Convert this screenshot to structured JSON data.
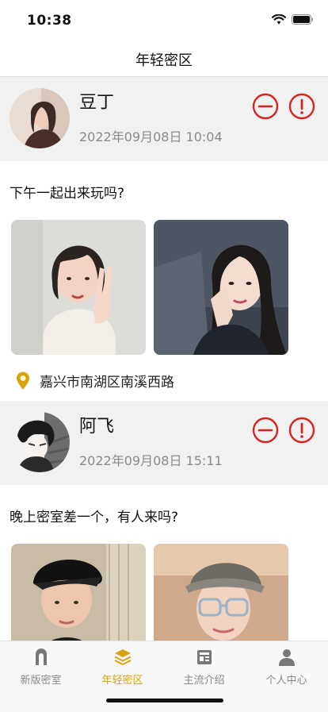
{
  "status_bar": {
    "time": "10:38"
  },
  "header": {
    "title": "年轻密区"
  },
  "posts": [
    {
      "username": "豆丁",
      "time": "2022年09月08日 10:04",
      "text": "下午一起出来玩吗?",
      "location": "嘉兴市南湖区南溪西路"
    },
    {
      "username": "阿飞",
      "time": "2022年09月08日 15:11",
      "text": "晚上密室差一个，有人来吗?"
    }
  ],
  "tabs": [
    {
      "label": "新版密室",
      "icon": "door-icon"
    },
    {
      "label": "年轻密区",
      "icon": "layers-icon",
      "active": true
    },
    {
      "label": "主流介绍",
      "icon": "news-icon"
    },
    {
      "label": "个人中心",
      "icon": "person-icon"
    }
  ],
  "colors": {
    "accent": "#d4a40a",
    "danger": "#d8231f",
    "header_bg": "#f1f1f1"
  }
}
